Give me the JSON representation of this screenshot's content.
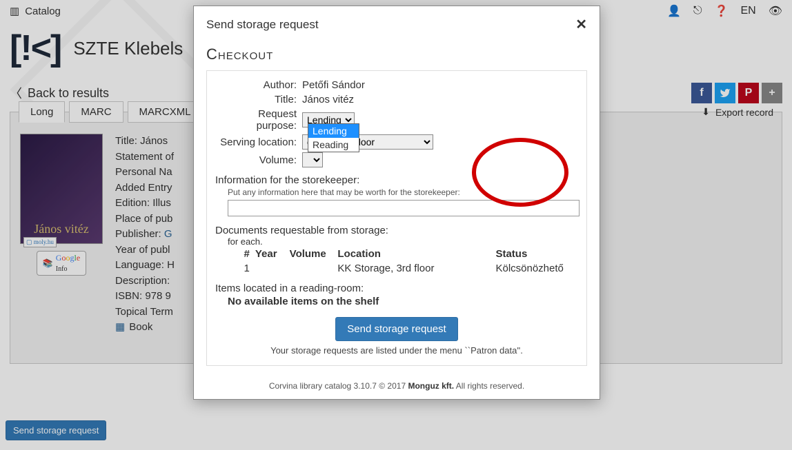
{
  "topbar": {
    "catalog_label": "Catalog",
    "lang": "EN"
  },
  "branding": {
    "title": "SZTE Klebels"
  },
  "back_link": "Back to results",
  "tabs": {
    "long": "Long",
    "marc": "MARC",
    "marcxml": "MARCXML"
  },
  "export_label": "Export record",
  "record": {
    "cover_title": "János vitéz",
    "moly": "moly.hu",
    "google_info": "Google\nInfo",
    "lines": {
      "title": "Title: János",
      "stmt": "Statement of",
      "pname": "Personal Na",
      "added": "Added Entry",
      "edition": "Edition: Illus",
      "place": "Place of pub",
      "publisher_label": "Publisher:",
      "publisher_link": "G",
      "year": "Year of publ",
      "lang": "Language: H",
      "desc": "Description:",
      "isbn": "ISBN: 978 9",
      "topical": "Topical Term",
      "type": "Book"
    }
  },
  "send_request_btn": "Send storage request",
  "modal": {
    "title": "Send storage request",
    "section": "Checkout",
    "author_label": "Author:",
    "author_value": "Petőfi Sándor",
    "title_label": "Title:",
    "title_value": "János vitéz",
    "purpose_label": "Request purpose:",
    "purpose_selected": "Lending",
    "purpose_options": [
      "Lending",
      "Reading"
    ],
    "serving_label": "Serving location:",
    "serving_value": "on, ground floor",
    "volume_label": "Volume:",
    "info_label": "Information for the storekeeper:",
    "info_hint": "Put any information here that may be worth for the storekeeper:",
    "docs_label": "Documents requestable from storage:",
    "foreach": "for each.",
    "table": {
      "headers": {
        "n": "#",
        "year": "Year",
        "volume": "Volume",
        "location": "Location",
        "status": "Status"
      },
      "rows": [
        {
          "n": "1",
          "year": "",
          "volume": "",
          "location": "KK Storage, 3rd floor",
          "status": "Kölcsönözhető"
        }
      ]
    },
    "items_label": "Items located in a reading-room:",
    "items_none": "No available items on the shelf",
    "submit": "Send storage request",
    "patron_hint": "Your storage requests are listed under the menu ``Patron data''.",
    "footer_pre": "Corvina library catalog 3.10.7 © 2017 ",
    "footer_company": "Monguz kft.",
    "footer_post": " All rights reserved."
  }
}
